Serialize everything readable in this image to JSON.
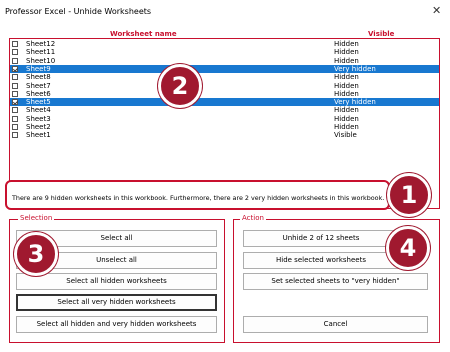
{
  "window": {
    "title": "Professor Excel - Unhide Worksheets",
    "close_glyph": "✕"
  },
  "table": {
    "col_name": "Worksheet name",
    "col_visible": "Visible",
    "rows": [
      {
        "name": "Sheet12",
        "visible": "Hidden",
        "checked": false,
        "selected": false
      },
      {
        "name": "Sheet11",
        "visible": "Hidden",
        "checked": false,
        "selected": false
      },
      {
        "name": "Sheet10",
        "visible": "Hidden",
        "checked": false,
        "selected": false
      },
      {
        "name": "Sheet9",
        "visible": "Very hidden",
        "checked": true,
        "selected": true
      },
      {
        "name": "Sheet8",
        "visible": "Hidden",
        "checked": false,
        "selected": false
      },
      {
        "name": "Sheet7",
        "visible": "Hidden",
        "checked": false,
        "selected": false
      },
      {
        "name": "Sheet6",
        "visible": "Hidden",
        "checked": false,
        "selected": false
      },
      {
        "name": "Sheet5",
        "visible": "Very hidden",
        "checked": true,
        "selected": true
      },
      {
        "name": "Sheet4",
        "visible": "Hidden",
        "checked": false,
        "selected": false
      },
      {
        "name": "Sheet3",
        "visible": "Hidden",
        "checked": false,
        "selected": false
      },
      {
        "name": "Sheet2",
        "visible": "Hidden",
        "checked": false,
        "selected": false
      },
      {
        "name": "Sheet1",
        "visible": "Visible",
        "checked": false,
        "selected": false
      }
    ]
  },
  "info": {
    "text": "There are 9 hidden worksheets in this workbook. Furthermore, there are 2 very hidden worksheets in this workbook."
  },
  "selection": {
    "label": "Selection",
    "select_all": "Select all",
    "unselect_all": "Unselect all",
    "select_hidden": "Select all hidden worksheets",
    "select_very_hidden": "Select all very hidden worksheets",
    "select_hidden_and_very": "Select all hidden and very hidden worksheets"
  },
  "action": {
    "label": "Action",
    "unhide": "Unhide 2 of 12 sheets",
    "hide_selected": "Hide selected worksheets",
    "set_very_hidden": "Set selected sheets to \"very hidden\"",
    "cancel": "Cancel"
  },
  "badges": {
    "b1": "1",
    "b2": "2",
    "b3": "3",
    "b4": "4"
  },
  "colors": {
    "accent": "#c8102e",
    "badge": "#a0192f",
    "selection": "#1878d0"
  }
}
